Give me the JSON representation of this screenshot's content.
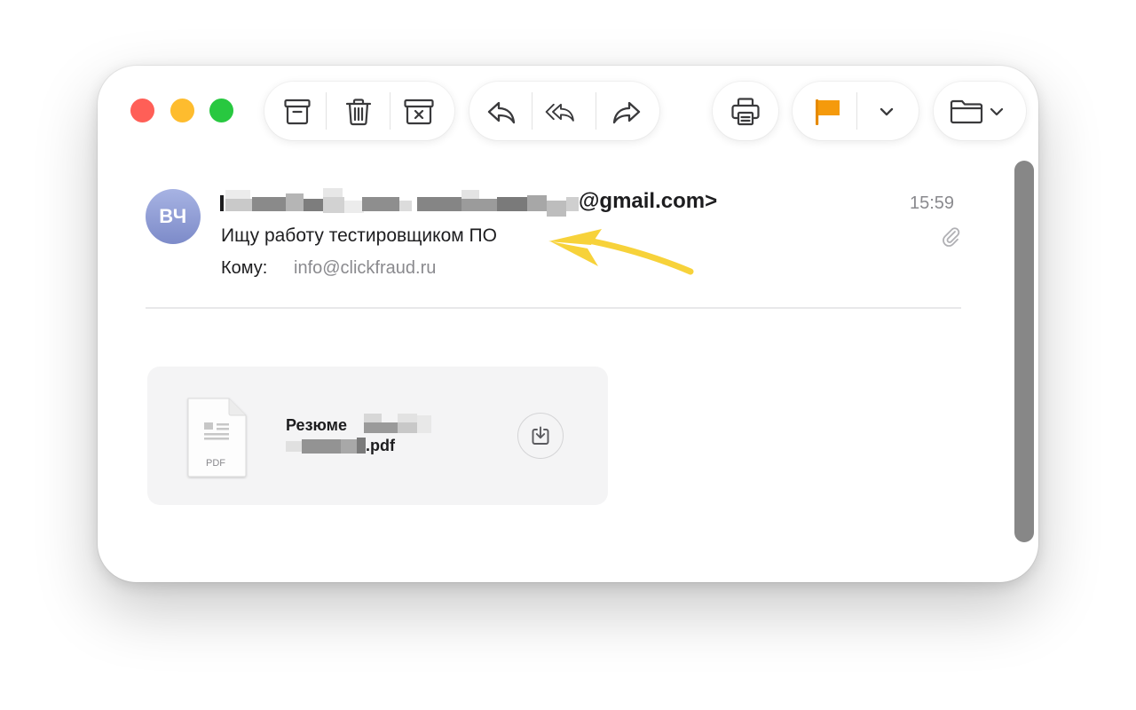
{
  "toolbar": {
    "icons": [
      "archive-icon",
      "trash-icon",
      "junk-icon",
      "reply-icon",
      "reply-all-icon",
      "forward-icon",
      "print-icon",
      "flag-icon",
      "chevron-down-icon",
      "folder-icon",
      "chevron-down-icon"
    ],
    "flag_color": "#f59a0c"
  },
  "message": {
    "avatar_initials": "ВЧ",
    "sender_email_suffix": "@gmail.com>",
    "time": "15:59",
    "subject": "Ищу работу тестировщиком ПО",
    "to_label": "Кому:",
    "to_value": "info@clickfraud.ru",
    "annotation_color": "#f7d23a"
  },
  "attachment": {
    "name_line1": "Резюме",
    "name_line2": ".pdf",
    "file_type": "PDF"
  },
  "colors": {
    "close": "#ff5f57",
    "minimize": "#febc2e",
    "zoom": "#28c840",
    "avatar": "#8e9bd3"
  }
}
